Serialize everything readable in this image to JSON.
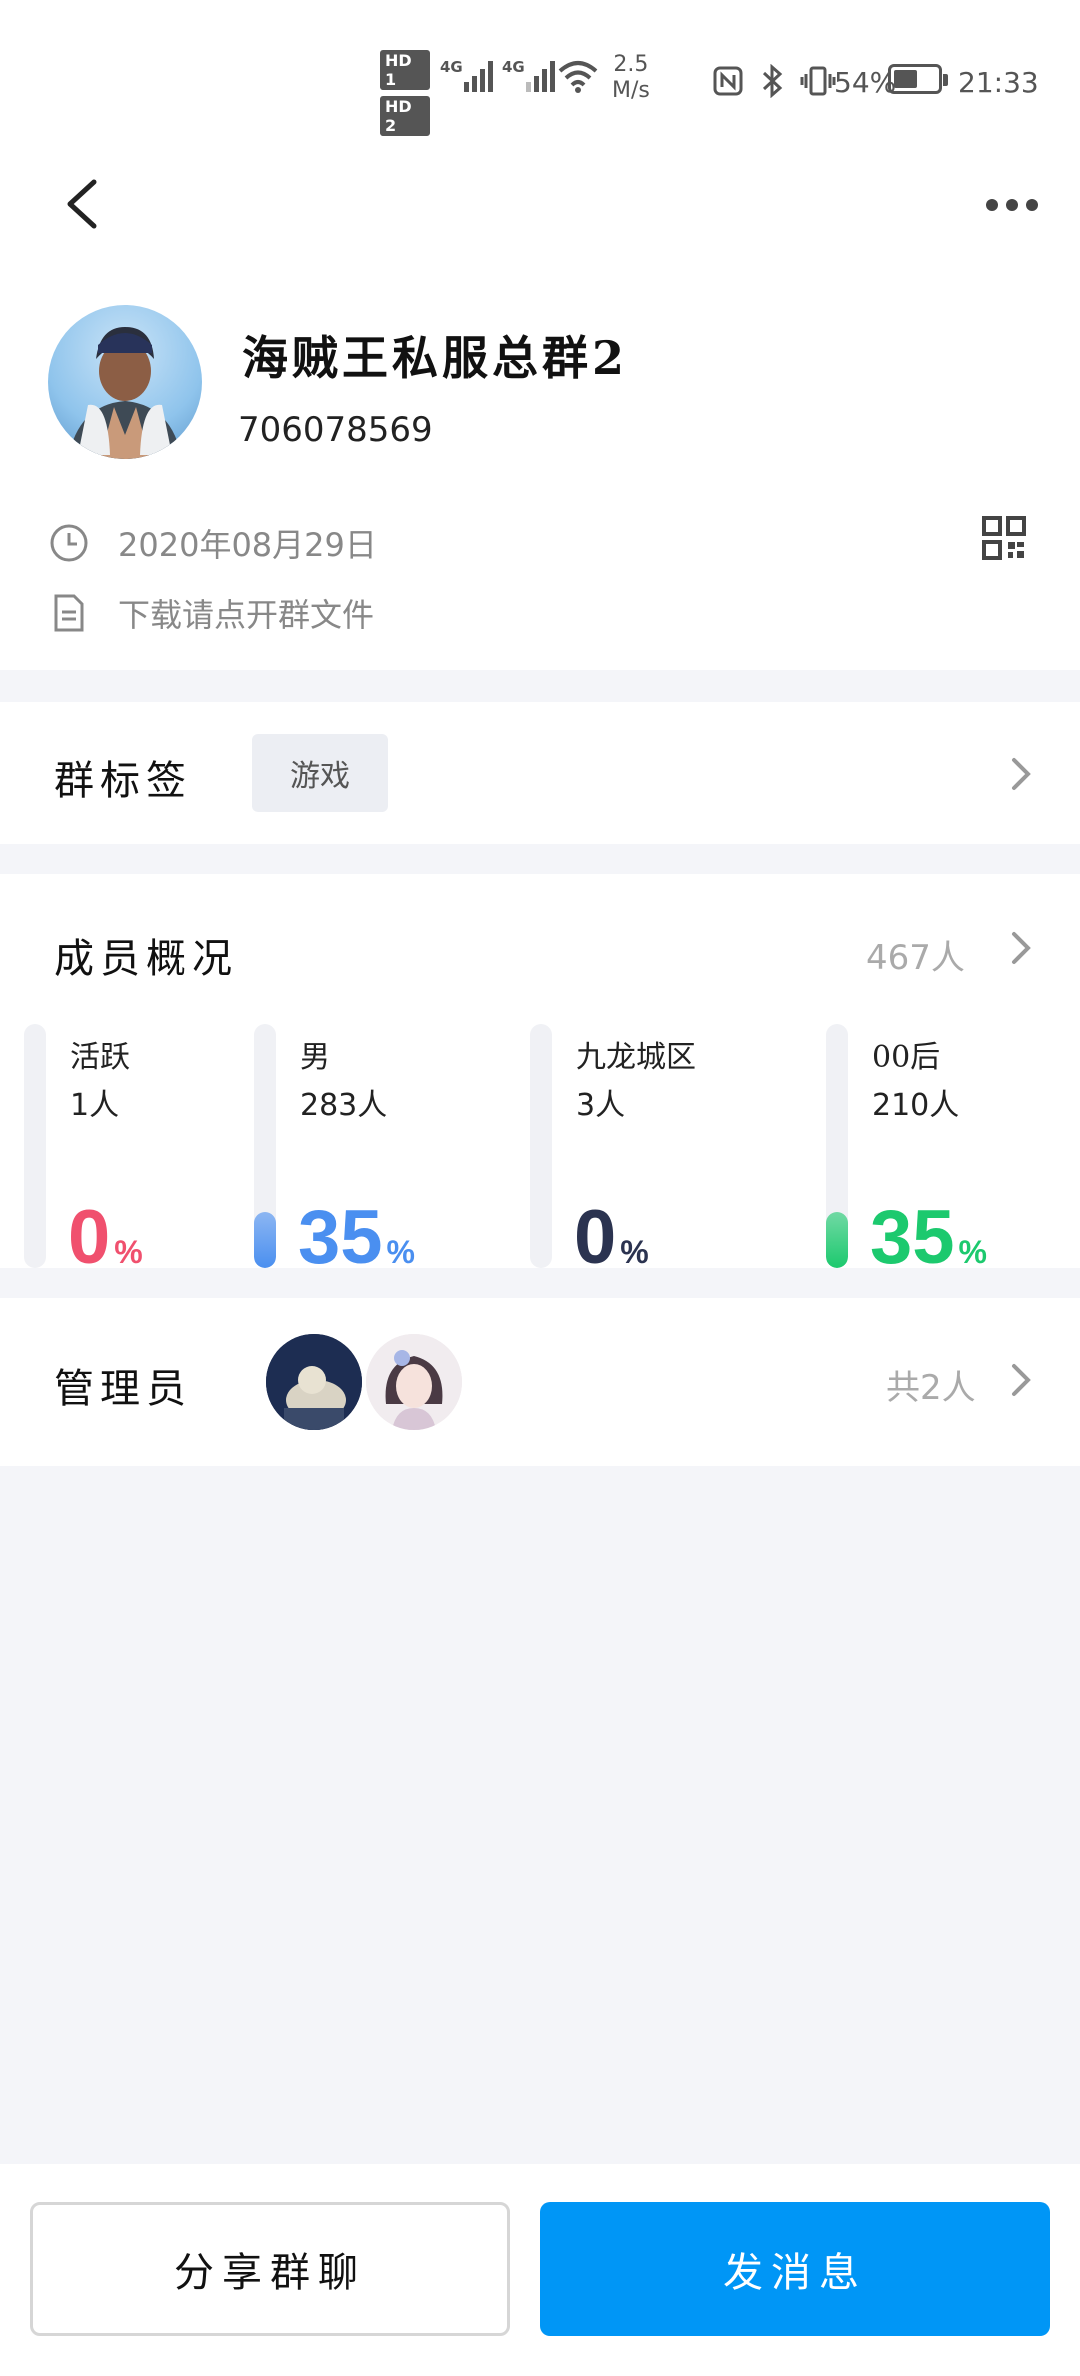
{
  "status_bar": {
    "hd1": "HD 1",
    "hd2": "HD 2",
    "net1": "4G",
    "net2": "4G",
    "speed_value": "2.5",
    "speed_unit": "M/s",
    "battery_pct": "54%",
    "battery_level": 0.54,
    "time": "21:33"
  },
  "group": {
    "name": "海贼王私服总群2",
    "id": "706078569",
    "created": "2020年08月29日",
    "notice": "下载请点开群文件"
  },
  "tags_section": {
    "title": "群标签",
    "tag": "游戏"
  },
  "members_section": {
    "title": "成员概况",
    "total": "467人",
    "stats": [
      {
        "label": "活跃",
        "count": "1人",
        "percent": "0",
        "unit": "%",
        "color": "#f0506e",
        "level": 0
      },
      {
        "label": "男",
        "count": "283人",
        "percent": "35",
        "unit": "%",
        "color": "#4a8ff0",
        "level": 0.35
      },
      {
        "label": "九龙城区",
        "count": "3人",
        "percent": "0",
        "unit": "%",
        "color": "#2b3350",
        "level": 0
      },
      {
        "label": "00后",
        "count": "210人",
        "percent": "35",
        "unit": "%",
        "color": "#1cc96e",
        "level": 0.35
      }
    ]
  },
  "admins_section": {
    "title": "管理员",
    "total": "共2人"
  },
  "bottom": {
    "share_label": "分享群聊",
    "send_label": "发消息"
  }
}
